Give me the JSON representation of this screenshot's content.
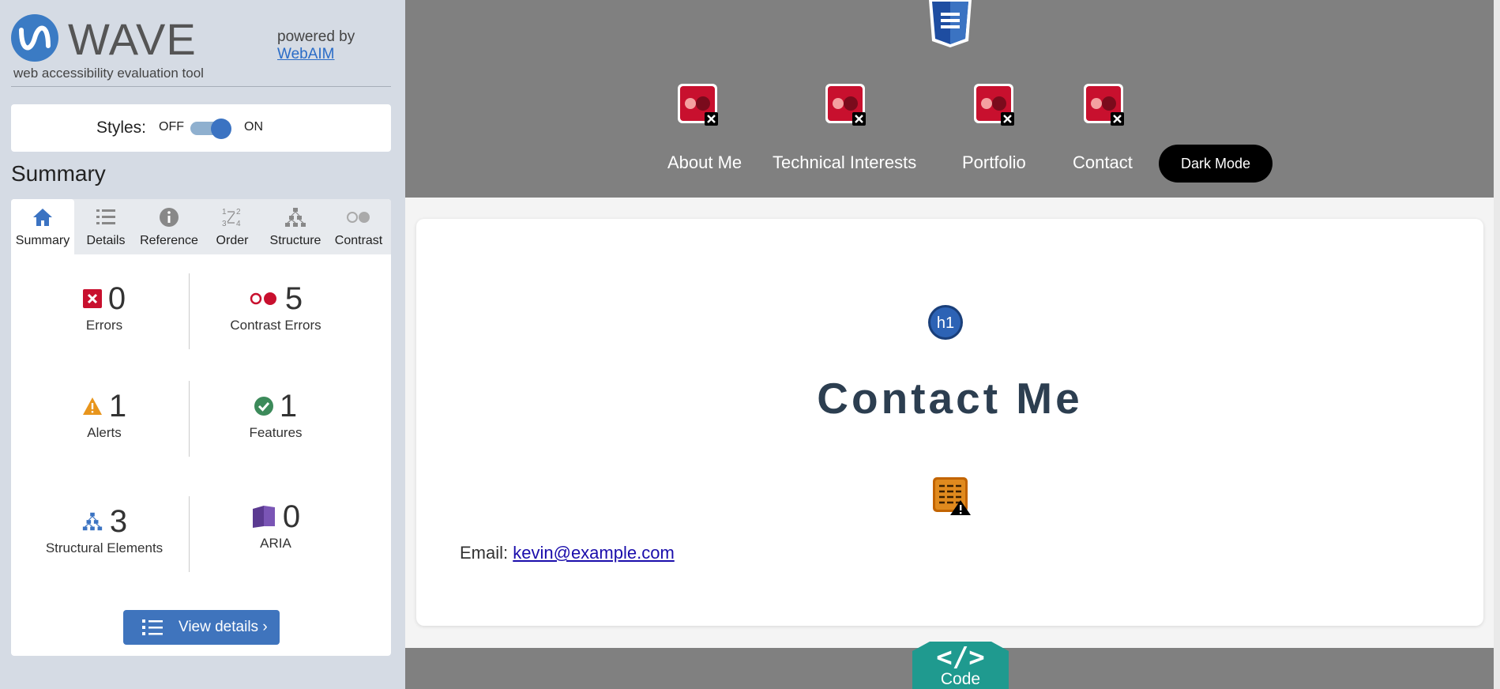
{
  "wave": {
    "logo_text": "WAVE",
    "subtitle": "web accessibility evaluation tool",
    "powered_by": "powered by",
    "webaim_link": "WebAIM",
    "styles_label": "Styles:",
    "styles_off": "OFF",
    "styles_on": "ON",
    "styles_enabled": true,
    "summary_heading": "Summary",
    "tabs": [
      {
        "label": "Summary",
        "icon": "home-icon",
        "active": true
      },
      {
        "label": "Details",
        "icon": "list-icon",
        "active": false
      },
      {
        "label": "Reference",
        "icon": "info-icon",
        "active": false
      },
      {
        "label": "Order",
        "icon": "order-icon",
        "active": false
      },
      {
        "label": "Structure",
        "icon": "structure-icon",
        "active": false
      },
      {
        "label": "Contrast",
        "icon": "contrast-icon",
        "active": false
      }
    ],
    "stats": {
      "errors": {
        "count": "0",
        "label": "Errors"
      },
      "contrast_errors": {
        "count": "5",
        "label": "Contrast Errors"
      },
      "alerts": {
        "count": "1",
        "label": "Alerts"
      },
      "features": {
        "count": "1",
        "label": "Features"
      },
      "structural": {
        "count": "3",
        "label": "Structural Elements"
      },
      "aria": {
        "count": "0",
        "label": "ARIA"
      }
    },
    "view_details": "View details ›",
    "colors": {
      "brand": "#3b7bc4",
      "error": "#c8102e",
      "alert": "#e8951c",
      "feature": "#3c8a5a",
      "aria": "#5b3a91"
    }
  },
  "site": {
    "nav": [
      {
        "label": "About Me"
      },
      {
        "label": "Technical Interests"
      },
      {
        "label": "Portfolio"
      },
      {
        "label": "Contact"
      }
    ],
    "dark_mode": "Dark Mode",
    "heading": "Contact Me",
    "h1_badge": "h1",
    "email_label": "Email:",
    "email_link": "kevin@example.com",
    "code_tab": "Code",
    "code_glyph": "</>"
  }
}
